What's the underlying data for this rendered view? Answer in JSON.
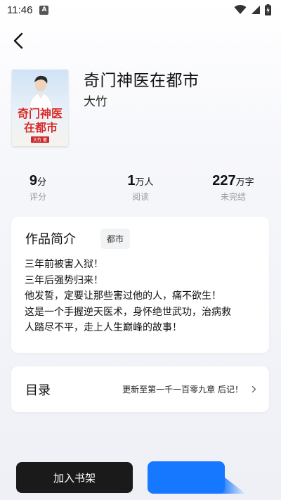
{
  "status_bar": {
    "time": "11:46",
    "notification_badge": "A",
    "icons": [
      "wifi-icon",
      "signal-icon",
      "battery-charging-icon"
    ]
  },
  "header": {
    "back_icon": "chevron-left-icon"
  },
  "book": {
    "title": "奇门神医在都市",
    "author": "大竹",
    "cover": {
      "title_line1": "奇门神医",
      "title_line2": "在都市",
      "author_stamp": "大竹 著"
    }
  },
  "stats": [
    {
      "value": "9",
      "unit": "分",
      "label": "评分"
    },
    {
      "value": "1",
      "unit": "万人",
      "label": "阅读"
    },
    {
      "value": "227",
      "unit": "万字",
      "label": "未完结"
    }
  ],
  "intro": {
    "heading": "作品简介",
    "tag": "都市",
    "lines": [
      "三年前被害入狱！",
      "三年后强势归来！",
      "他发誓，定要让那些害过他的人，痛不欲生！",
      "这是一个手握逆天医术，身怀绝世武功，治病救",
      "人踏尽不平，走上人生巅峰的故事！"
    ]
  },
  "toc": {
    "heading": "目录",
    "latest": "更新至第一千一百零九章  后记！",
    "chevron_icon": "chevron-right-icon"
  },
  "actions": {
    "add_to_shelf": "加入书架",
    "read_button_color": "#1677ff"
  },
  "colors": {
    "accent": "#1677ff",
    "dark_button": "#1a1a1a",
    "muted_text": "#999999",
    "cover_title": "#d42a2a"
  }
}
